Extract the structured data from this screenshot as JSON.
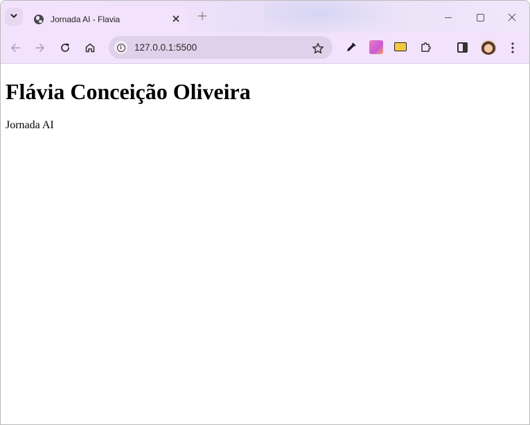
{
  "browser": {
    "tab": {
      "title": "Jornada AI - Flavia",
      "favicon": "globe-icon",
      "close_icon": "close-icon"
    },
    "tab_search_icon": "chevron-down-icon",
    "new_tab_icon": "plus-icon",
    "window_controls": {
      "minimize_icon": "minimize-icon",
      "maximize_icon": "maximize-icon",
      "close_icon": "close-icon"
    },
    "toolbar": {
      "back_icon": "back-arrow-icon",
      "forward_icon": "forward-arrow-icon",
      "reload_icon": "reload-icon",
      "home_icon": "home-icon",
      "url": "127.0.0.1:5500",
      "site_info_icon": "info-icon",
      "bookmark_icon": "star-icon",
      "extensions": [
        "eyedropper-icon",
        "gradient-extension-icon",
        "folder-extension-icon",
        "puzzle-icon"
      ],
      "side_panel_icon": "side-panel-icon",
      "profile_icon": "avatar-icon",
      "menu_icon": "more-vert-icon"
    }
  },
  "page": {
    "heading": "Flávia Conceição Oliveira",
    "paragraph": "Jornada AI"
  },
  "colors": {
    "frame": "#f2e2fb",
    "omnibox": "#e0d1ea",
    "content_bg": "#ffffff"
  }
}
